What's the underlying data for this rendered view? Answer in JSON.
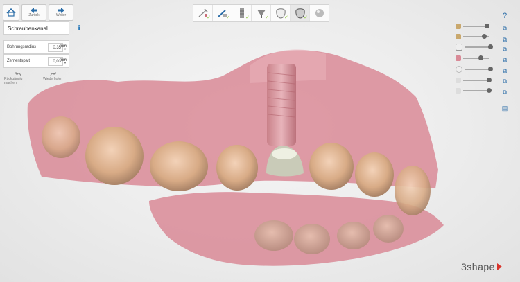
{
  "nav": {
    "back_label": "Zurück",
    "forward_label": "Weiter"
  },
  "panel": {
    "title": "Schraubenkanal",
    "params": [
      {
        "label": "Bohrungsradius",
        "value": "0,35",
        "unit": "mm"
      },
      {
        "label": "Zementspalt",
        "value": "0,03",
        "unit": "mm"
      }
    ],
    "undo_label": "Rückgängig machen",
    "redo_label": "Wiederholen"
  },
  "toolbar": {
    "tools": [
      "screw-sketch-icon",
      "screw-edit-icon",
      "abutment-post-icon",
      "abutment-cone-icon",
      "crown-outline-icon",
      "crown-filled-icon",
      "sphere-icon"
    ]
  },
  "visibility": {
    "sliders": [
      0.85,
      0.75,
      0.95,
      0.6,
      0.95,
      0.95
    ]
  },
  "colors": {
    "accent": "#2b6da8",
    "check": "#8dc63f",
    "gingiva": "#d98a97",
    "logo_red": "#d9342b"
  },
  "brand": "3shape"
}
